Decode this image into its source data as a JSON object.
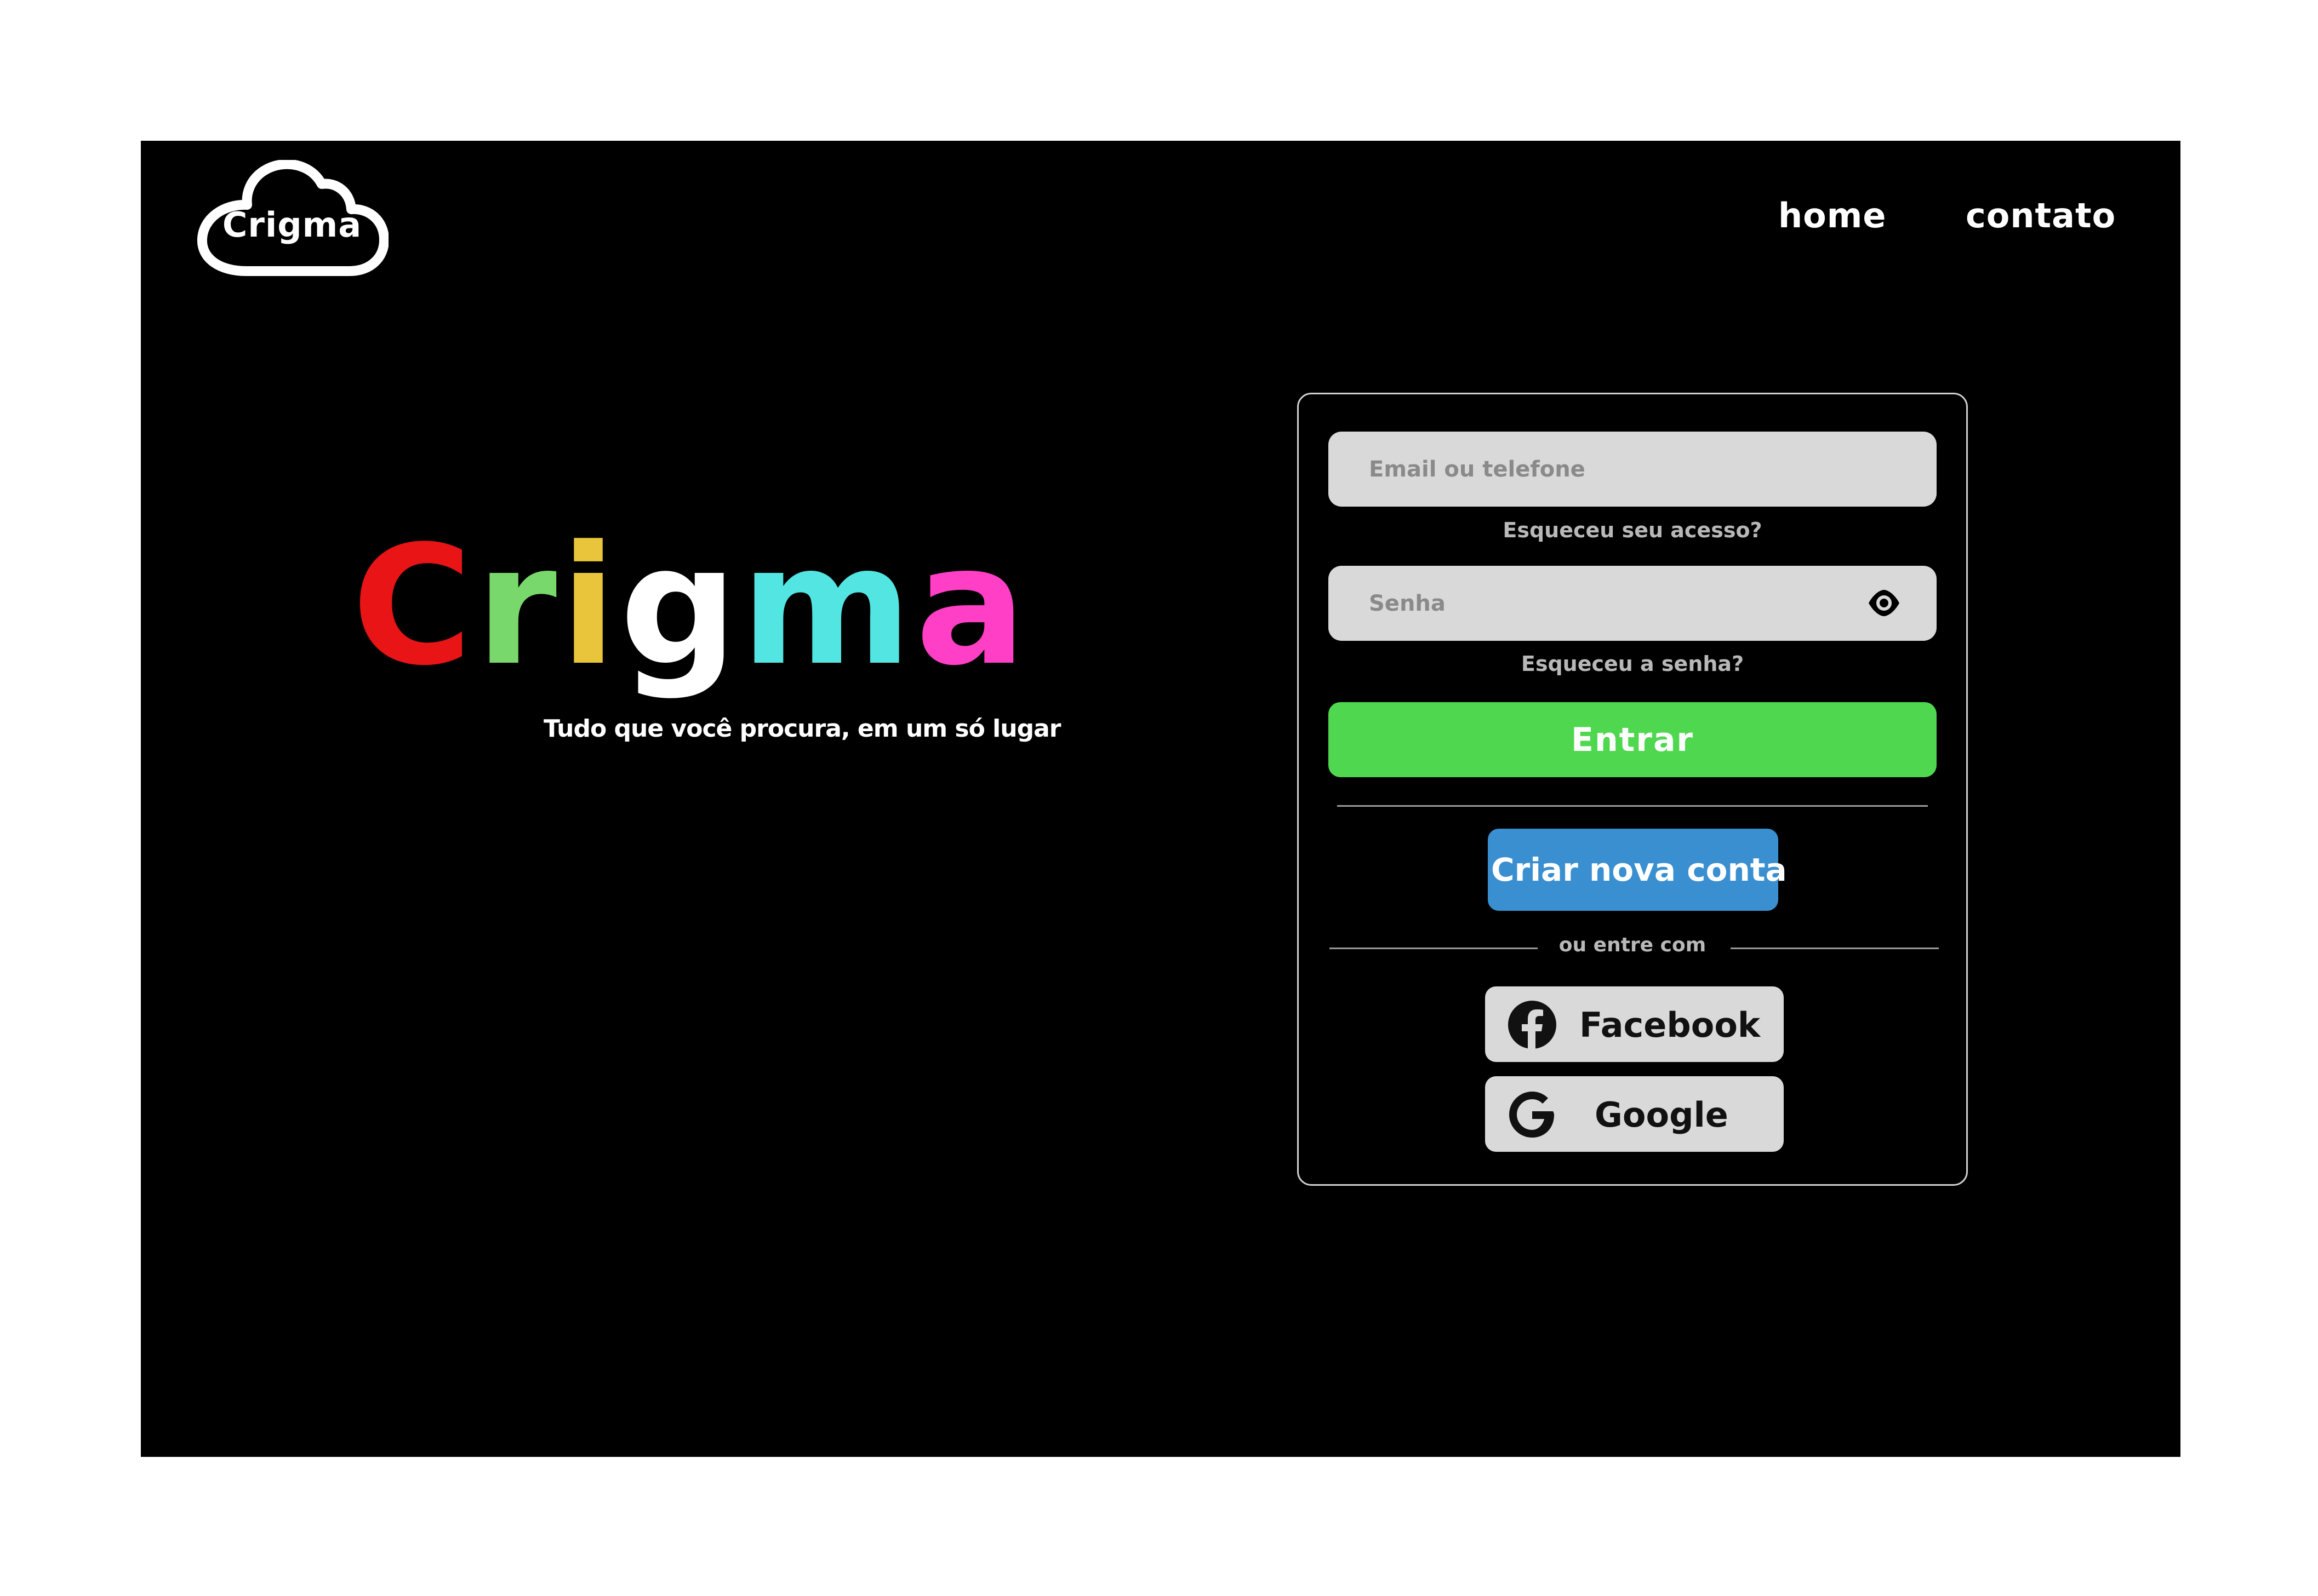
{
  "header": {
    "logo_text": "Crigma",
    "nav": [
      {
        "label": "home"
      },
      {
        "label": "contato"
      }
    ]
  },
  "hero": {
    "title_letters": [
      {
        "char": "C",
        "color": "#e81416"
      },
      {
        "char": "r",
        "color": "#79d86b"
      },
      {
        "char": "i",
        "color": "#e8c53a"
      },
      {
        "char": "g",
        "color": "#ffffff"
      },
      {
        "char": "m",
        "color": "#52e5e2"
      },
      {
        "char": "a",
        "color": "#ff3fc5"
      }
    ],
    "subtitle": "Tudo que você procura, em um só lugar"
  },
  "login": {
    "email_placeholder": "Email ou telefone",
    "forgot_access": "Esqueceu seu acesso?",
    "password_placeholder": "Senha",
    "forgot_password": "Esqueceu a senha?",
    "submit_label": "Entrar",
    "create_account_label": "Criar nova conta",
    "or_text": "ou entre com",
    "social": [
      {
        "label": "Facebook",
        "icon": "facebook-icon"
      },
      {
        "label": "Google",
        "icon": "google-icon"
      }
    ]
  },
  "colors": {
    "background": "#000000",
    "submit": "#4fd84f",
    "create_account": "#3a8fd0",
    "field": "#d9d9d9"
  }
}
